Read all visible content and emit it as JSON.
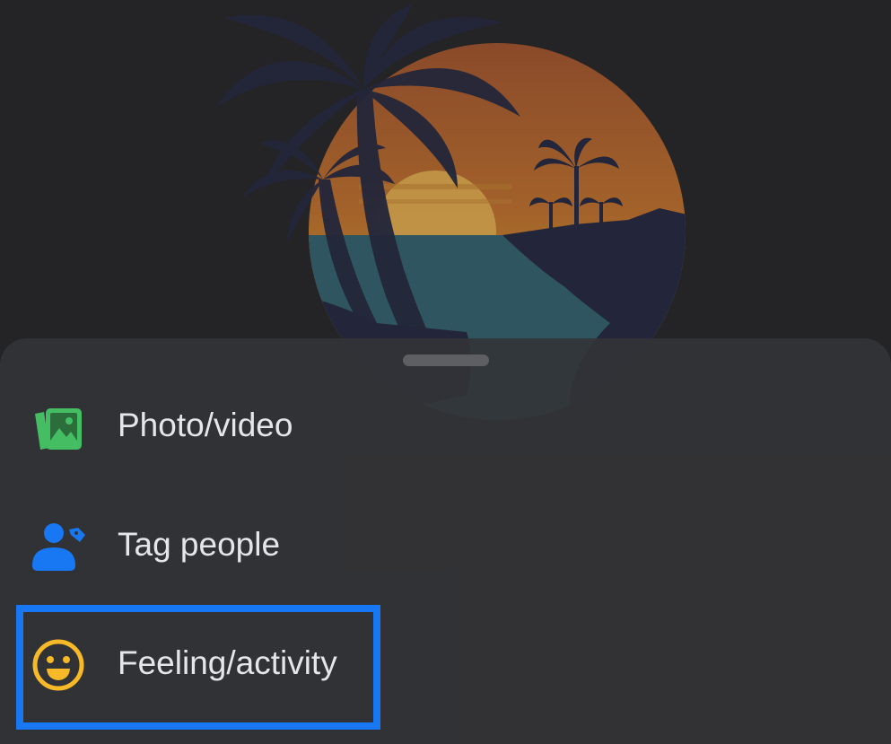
{
  "colors": {
    "background": "#242426",
    "sheet": "#333437",
    "text": "#e4e6eb",
    "photo_icon": "#45bd62",
    "tag_icon": "#1877f2",
    "feeling_icon": "#f7b928",
    "highlight": "#1877f2"
  },
  "background_image": {
    "icon": "tropical-sunset-palm-trees-image"
  },
  "sheet": {
    "handle_icon": "drag-handle",
    "items": [
      {
        "label": "Photo/video",
        "icon": "photo-video-icon"
      },
      {
        "label": "Tag people",
        "icon": "tag-people-icon"
      },
      {
        "label": "Feeling/activity",
        "icon": "smiley-face-icon",
        "highlighted": true
      }
    ]
  }
}
